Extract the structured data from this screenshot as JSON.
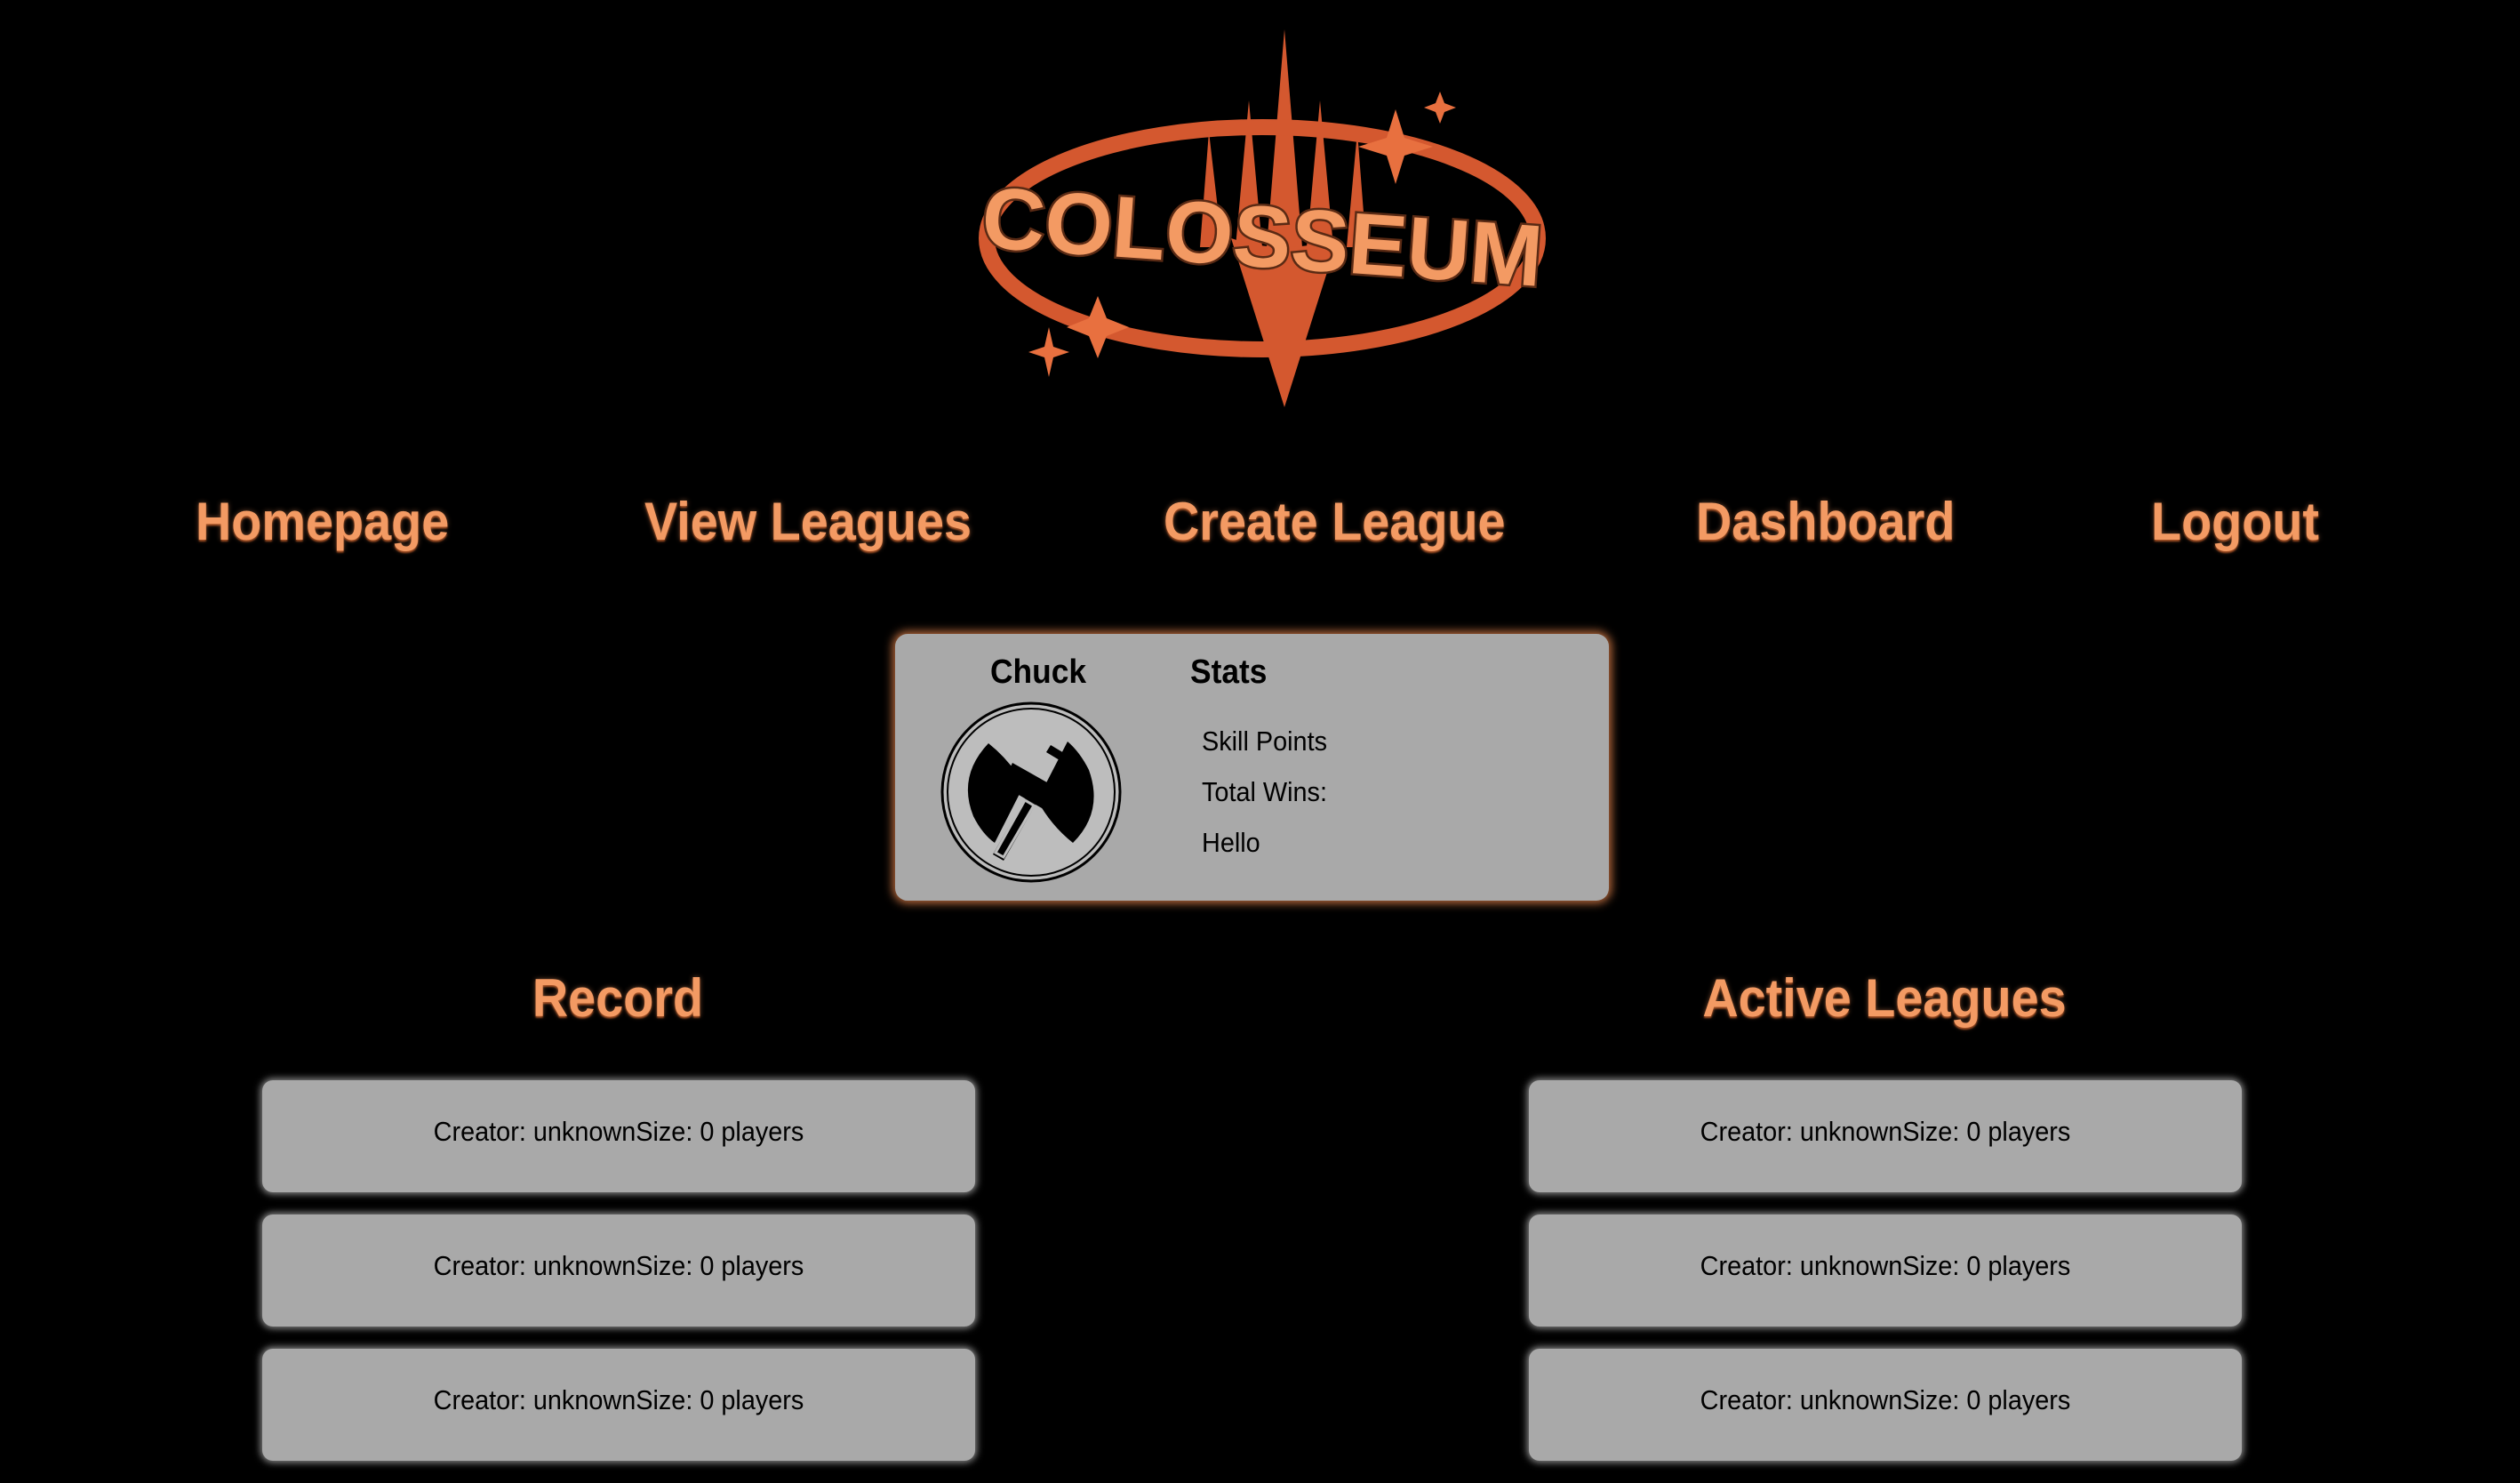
{
  "brand": {
    "logo_text": "COLOSSEUM"
  },
  "colors": {
    "background": "#000000",
    "accent": "#f39a63",
    "logo_dark": "#d0532e",
    "card": "#a9a9a9"
  },
  "nav": {
    "items": [
      {
        "label": "Homepage"
      },
      {
        "label": "View Leagues"
      },
      {
        "label": "Create League"
      },
      {
        "label": "Dashboard"
      },
      {
        "label": "Logout"
      }
    ]
  },
  "profile": {
    "name": "Chuck",
    "avatar_icon": "battle-axe-icon",
    "stats_title": "Stats",
    "stats": [
      "Skill Points",
      "Total Wins:",
      "Hello"
    ]
  },
  "record": {
    "title": "Record",
    "items": [
      "Creator: unknownSize: 0 players",
      "Creator: unknownSize: 0 players",
      "Creator: unknownSize: 0 players"
    ]
  },
  "active_leagues": {
    "title": "Active Leagues",
    "items": [
      "Creator: unknownSize: 0 players",
      "Creator: unknownSize: 0 players",
      "Creator: unknownSize: 0 players"
    ]
  }
}
